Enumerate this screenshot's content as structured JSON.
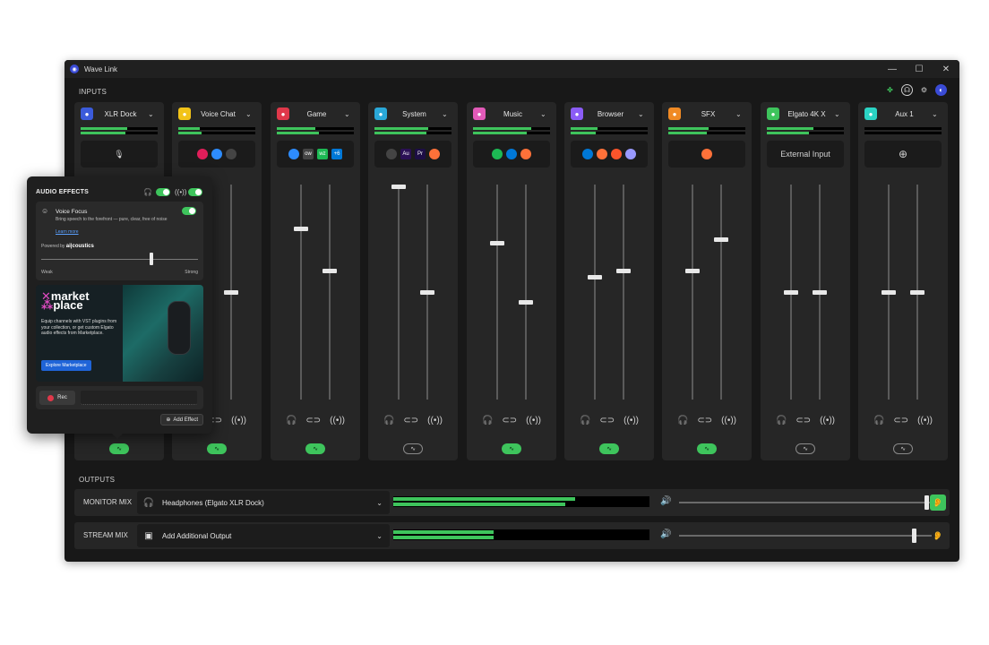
{
  "window": {
    "title": "Wave Link",
    "controls": {
      "minimize": "—",
      "maximize": "☐",
      "close": "✕"
    }
  },
  "inputs_label": "INPUTS",
  "outputs_label": "OUTPUTS",
  "top_icons": [
    "marketplace-icon",
    "profile-icon",
    "settings-icon",
    "account-icon"
  ],
  "channels": [
    {
      "name": "XLR Dock",
      "icon_color": "#3b5bdb",
      "meter1": 0.6,
      "meter2": 0.58,
      "source_type": "mic",
      "fader_left": null,
      "fader_right": null,
      "fx_on": true
    },
    {
      "name": "Voice Chat",
      "icon_color": "#f2c318",
      "meter1": 0.28,
      "meter2": 0.3,
      "apps": [
        "discord",
        "slack",
        "zoom"
      ],
      "fader_left": null,
      "fader_right": 0.5,
      "fx_on": true
    },
    {
      "name": "Game",
      "icon_color": "#e0384a",
      "meter1": 0.5,
      "meter2": 0.55,
      "apps": [
        "fortnite",
        "ow",
        "wz",
        "+6"
      ],
      "fader_left": 0.8,
      "fader_right": 0.6,
      "fx_on": true
    },
    {
      "name": "System",
      "icon_color": "#2aa8d8",
      "meter1": 0.7,
      "meter2": 0.68,
      "apps": [
        "steam",
        "Au",
        "Pr",
        "clap"
      ],
      "fader_left": 1.0,
      "fader_right": 0.5,
      "fx_on": false
    },
    {
      "name": "Music",
      "icon_color": "#e25ab8",
      "meter1": 0.75,
      "meter2": 0.7,
      "apps": [
        "spotify",
        "alien",
        "vlc"
      ],
      "fader_left": 0.73,
      "fader_right": 0.45,
      "fx_on": true
    },
    {
      "name": "Browser",
      "icon_color": "#8b5cf6",
      "meter1": 0.35,
      "meter2": 0.33,
      "apps": [
        "chrome",
        "edge",
        "firefox",
        "brave"
      ],
      "fader_left": 0.57,
      "fader_right": 0.6,
      "fx_on": true
    },
    {
      "name": "SFX",
      "icon_color": "#f08a24",
      "meter1": 0.52,
      "meter2": 0.5,
      "apps": [
        "deck"
      ],
      "fader_left": 0.6,
      "fader_right": 0.75,
      "fx_on": true
    },
    {
      "name": "Elgato 4K X",
      "icon_color": "#3ec45c",
      "meter1": 0.6,
      "meter2": 0.55,
      "source_text": "External Input",
      "fader_left": 0.5,
      "fader_right": 0.5,
      "fx_on": false
    },
    {
      "name": "Aux 1",
      "icon_color": "#2bd4c4",
      "meter1": 0.0,
      "meter2": 0.0,
      "source_type": "add",
      "fader_left": 0.5,
      "fader_right": 0.5,
      "fx_on": false
    }
  ],
  "outputs": [
    {
      "label": "MONITOR MIX",
      "device": "Headphones (Elgato XLR Dock)",
      "meter1": 0.71,
      "meter2": 0.67,
      "level": 0.99,
      "ear_active": true
    },
    {
      "label": "STREAM MIX",
      "device": "Add Additional Output",
      "meter1": 0.39,
      "meter2": 0.39,
      "level": 0.94,
      "ear_active": false
    }
  ],
  "audio_effects": {
    "title": "AUDIO EFFECTS",
    "voice_focus": {
      "title": "Voice Focus",
      "description": "Bring speech to the forefront — pure, clear, free of noise",
      "learn_more": "Learn more",
      "powered_by": "Powered by",
      "brand": "ai|coustics",
      "weak": "Weak",
      "strong": "Strong",
      "strength": 0.7
    },
    "marketplace": {
      "logo_line1": "market",
      "logo_line2": "place",
      "description": "Equip channels with VST plugins from your collection, or get custom Elgato audio effects from Marketplace.",
      "button": "Explore Marketplace"
    },
    "rec_label": "Rec",
    "add_effect_label": "Add Effect"
  }
}
